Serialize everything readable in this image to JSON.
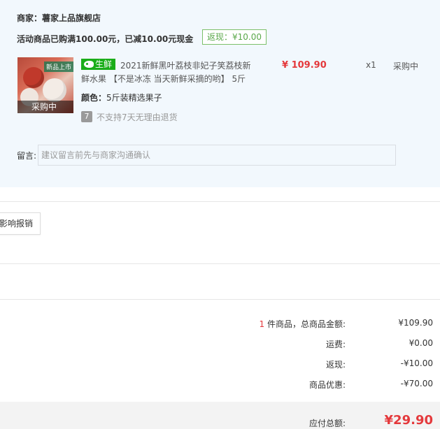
{
  "shop": {
    "merchant": "商家：薯家上品旗舰店",
    "promo": "活动商品已购满100.00元，已减10.00元现金",
    "cashback_badge": "返现：¥10.00"
  },
  "item": {
    "thumb_banner": "新品上市",
    "thumb_status": "采购中",
    "fresh_tag": "生鲜",
    "title_line1": "2021新鲜黑叶荔枝非妃子笑荔枝新",
    "title_line2": "鲜水果 【不是冰冻 当天新鲜采摘的哟】 5斤",
    "color_label": "颜色：",
    "color_value": "5斤装精选果子",
    "no_return_icon": "7",
    "no_return_text": "不支持7天无理由退货",
    "price": "¥ 109.90",
    "qty": "x1",
    "status": "采购中"
  },
  "note": {
    "label": "留言:",
    "placeholder": "建议留言前先与商家沟通确认"
  },
  "report_button": "影响报销",
  "summary": {
    "goods_count": "1",
    "goods_label": "件商品，总商品金额:",
    "goods_amount": "¥109.90",
    "shipping_label": "运费:",
    "shipping_amount": "¥0.00",
    "cashback_label": "返现:",
    "cashback_amount": "-¥10.00",
    "discount_label": "商品优惠:",
    "discount_amount": "-¥70.00",
    "total_label": "应付总额:",
    "total_amount": "¥29.90"
  },
  "colors": {
    "accent_red": "#e4393c",
    "fresh_green": "#1aad19",
    "panel_bg": "#f2f8fd"
  }
}
